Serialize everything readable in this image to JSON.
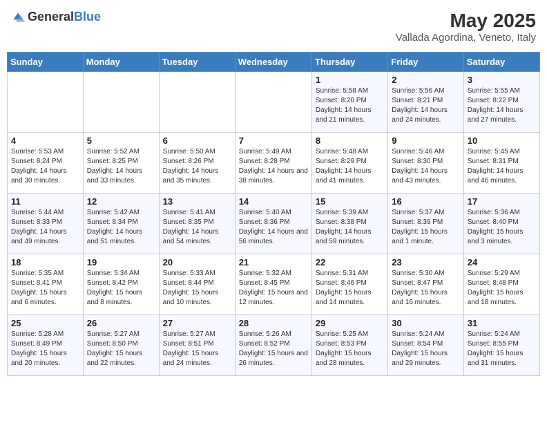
{
  "header": {
    "logo_general": "General",
    "logo_blue": "Blue",
    "month": "May 2025",
    "location": "Vallada Agordina, Veneto, Italy"
  },
  "days_of_week": [
    "Sunday",
    "Monday",
    "Tuesday",
    "Wednesday",
    "Thursday",
    "Friday",
    "Saturday"
  ],
  "weeks": [
    [
      {
        "day": "",
        "sunrise": "",
        "sunset": "",
        "daylight": ""
      },
      {
        "day": "",
        "sunrise": "",
        "sunset": "",
        "daylight": ""
      },
      {
        "day": "",
        "sunrise": "",
        "sunset": "",
        "daylight": ""
      },
      {
        "day": "",
        "sunrise": "",
        "sunset": "",
        "daylight": ""
      },
      {
        "day": "1",
        "sunrise": "5:58 AM",
        "sunset": "8:20 PM",
        "daylight": "14 hours and 21 minutes."
      },
      {
        "day": "2",
        "sunrise": "5:56 AM",
        "sunset": "8:21 PM",
        "daylight": "14 hours and 24 minutes."
      },
      {
        "day": "3",
        "sunrise": "5:55 AM",
        "sunset": "8:22 PM",
        "daylight": "14 hours and 27 minutes."
      }
    ],
    [
      {
        "day": "4",
        "sunrise": "5:53 AM",
        "sunset": "8:24 PM",
        "daylight": "14 hours and 30 minutes."
      },
      {
        "day": "5",
        "sunrise": "5:52 AM",
        "sunset": "8:25 PM",
        "daylight": "14 hours and 33 minutes."
      },
      {
        "day": "6",
        "sunrise": "5:50 AM",
        "sunset": "8:26 PM",
        "daylight": "14 hours and 35 minutes."
      },
      {
        "day": "7",
        "sunrise": "5:49 AM",
        "sunset": "8:28 PM",
        "daylight": "14 hours and 38 minutes."
      },
      {
        "day": "8",
        "sunrise": "5:48 AM",
        "sunset": "8:29 PM",
        "daylight": "14 hours and 41 minutes."
      },
      {
        "day": "9",
        "sunrise": "5:46 AM",
        "sunset": "8:30 PM",
        "daylight": "14 hours and 43 minutes."
      },
      {
        "day": "10",
        "sunrise": "5:45 AM",
        "sunset": "8:31 PM",
        "daylight": "14 hours and 46 minutes."
      }
    ],
    [
      {
        "day": "11",
        "sunrise": "5:44 AM",
        "sunset": "8:33 PM",
        "daylight": "14 hours and 49 minutes."
      },
      {
        "day": "12",
        "sunrise": "5:42 AM",
        "sunset": "8:34 PM",
        "daylight": "14 hours and 51 minutes."
      },
      {
        "day": "13",
        "sunrise": "5:41 AM",
        "sunset": "8:35 PM",
        "daylight": "14 hours and 54 minutes."
      },
      {
        "day": "14",
        "sunrise": "5:40 AM",
        "sunset": "8:36 PM",
        "daylight": "14 hours and 56 minutes."
      },
      {
        "day": "15",
        "sunrise": "5:39 AM",
        "sunset": "8:38 PM",
        "daylight": "14 hours and 59 minutes."
      },
      {
        "day": "16",
        "sunrise": "5:37 AM",
        "sunset": "8:39 PM",
        "daylight": "15 hours and 1 minute."
      },
      {
        "day": "17",
        "sunrise": "5:36 AM",
        "sunset": "8:40 PM",
        "daylight": "15 hours and 3 minutes."
      }
    ],
    [
      {
        "day": "18",
        "sunrise": "5:35 AM",
        "sunset": "8:41 PM",
        "daylight": "15 hours and 6 minutes."
      },
      {
        "day": "19",
        "sunrise": "5:34 AM",
        "sunset": "8:42 PM",
        "daylight": "15 hours and 8 minutes."
      },
      {
        "day": "20",
        "sunrise": "5:33 AM",
        "sunset": "8:44 PM",
        "daylight": "15 hours and 10 minutes."
      },
      {
        "day": "21",
        "sunrise": "5:32 AM",
        "sunset": "8:45 PM",
        "daylight": "15 hours and 12 minutes."
      },
      {
        "day": "22",
        "sunrise": "5:31 AM",
        "sunset": "8:46 PM",
        "daylight": "15 hours and 14 minutes."
      },
      {
        "day": "23",
        "sunrise": "5:30 AM",
        "sunset": "8:47 PM",
        "daylight": "15 hours and 16 minutes."
      },
      {
        "day": "24",
        "sunrise": "5:29 AM",
        "sunset": "8:48 PM",
        "daylight": "15 hours and 18 minutes."
      }
    ],
    [
      {
        "day": "25",
        "sunrise": "5:28 AM",
        "sunset": "8:49 PM",
        "daylight": "15 hours and 20 minutes."
      },
      {
        "day": "26",
        "sunrise": "5:27 AM",
        "sunset": "8:50 PM",
        "daylight": "15 hours and 22 minutes."
      },
      {
        "day": "27",
        "sunrise": "5:27 AM",
        "sunset": "8:51 PM",
        "daylight": "15 hours and 24 minutes."
      },
      {
        "day": "28",
        "sunrise": "5:26 AM",
        "sunset": "8:52 PM",
        "daylight": "15 hours and 26 minutes."
      },
      {
        "day": "29",
        "sunrise": "5:25 AM",
        "sunset": "8:53 PM",
        "daylight": "15 hours and 28 minutes."
      },
      {
        "day": "30",
        "sunrise": "5:24 AM",
        "sunset": "8:54 PM",
        "daylight": "15 hours and 29 minutes."
      },
      {
        "day": "31",
        "sunrise": "5:24 AM",
        "sunset": "8:55 PM",
        "daylight": "15 hours and 31 minutes."
      }
    ]
  ]
}
